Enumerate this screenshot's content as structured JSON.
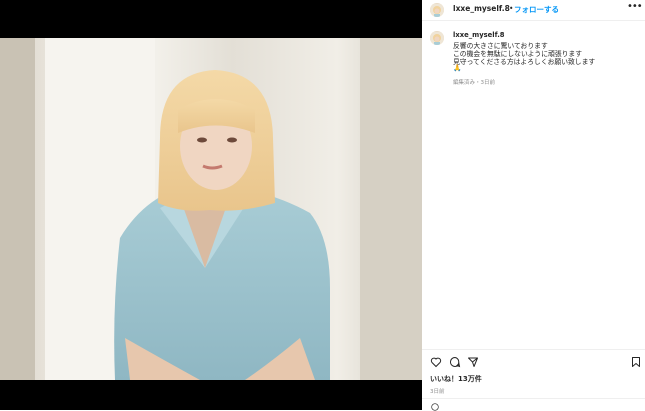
{
  "post": {
    "username": "lxxe_myself.8",
    "dot": "•",
    "follow_label": "フォローする",
    "more_label": "•••"
  },
  "caption": {
    "username": "lxxe_myself.8",
    "lines": [
      "反響の大きさに驚いております",
      "この機会を無駄にしないように頑張ります",
      "見守ってくださる方はよろしくお願い致します",
      "🙏"
    ],
    "meta": "編集済み・3日前"
  },
  "actions": {
    "icons": [
      "heart-icon",
      "comment-icon",
      "share-icon",
      "bookmark-icon"
    ]
  },
  "likes": "いいね！13万件",
  "date": "3日前",
  "colors": {
    "follow": "#0095f6",
    "text": "#262626",
    "muted": "#8e8e8e",
    "photo_bg": "#000000"
  }
}
